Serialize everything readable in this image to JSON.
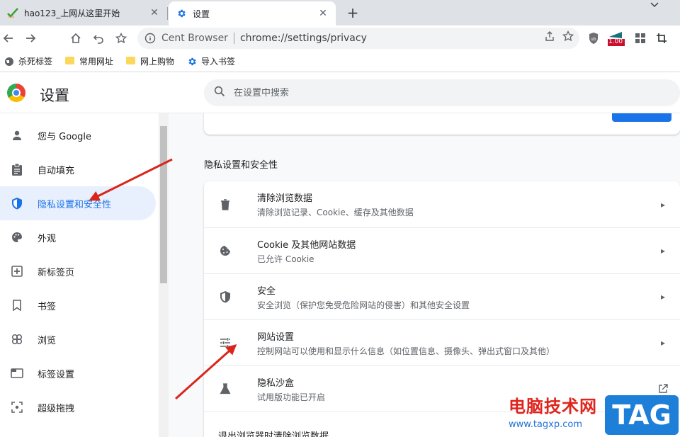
{
  "tabs": [
    {
      "title": "hao123_上网从这里开始",
      "active": false
    },
    {
      "title": "设置",
      "active": true
    }
  ],
  "toolbar": {
    "brand": "Cent Browser",
    "url": "chrome://settings/privacy",
    "ext_badge": "1.00"
  },
  "bookmarks": [
    {
      "label": "杀死标签",
      "icon": "globe-icon"
    },
    {
      "label": "常用网址",
      "icon": "folder-icon"
    },
    {
      "label": "网上购物",
      "icon": "folder-icon"
    },
    {
      "label": "导入书签",
      "icon": "gear-icon"
    }
  ],
  "header": {
    "title": "设置",
    "search_placeholder": "在设置中搜索"
  },
  "sidebar": {
    "items": [
      {
        "label": "您与 Google",
        "icon": "person-icon"
      },
      {
        "label": "自动填充",
        "icon": "clipboard-icon"
      },
      {
        "label": "隐私设置和安全性",
        "icon": "shield-icon",
        "active": true
      },
      {
        "label": "外观",
        "icon": "palette-icon"
      },
      {
        "label": "新标签页",
        "icon": "new-tab-icon"
      },
      {
        "label": "书签",
        "icon": "bookmark-icon"
      },
      {
        "label": "浏览",
        "icon": "browse-icon"
      },
      {
        "label": "标签设置",
        "icon": "tab-icon"
      },
      {
        "label": "超级拖拽",
        "icon": "drag-icon"
      }
    ]
  },
  "main": {
    "section_title": "隐私设置和安全性",
    "rows": [
      {
        "title": "清除浏览数据",
        "subtitle": "清除浏览记录、Cookie、缓存及其他数据",
        "icon": "trash-icon",
        "action": "chevron"
      },
      {
        "title": "Cookie 及其他网站数据",
        "subtitle": "已允许 Cookie",
        "icon": "cookie-icon",
        "action": "chevron"
      },
      {
        "title": "安全",
        "subtitle": "安全浏览（保护您免受危险网站的侵害）和其他安全设置",
        "icon": "shield-icon",
        "action": "chevron"
      },
      {
        "title": "网站设置",
        "subtitle": "控制网站可以使用和显示什么信息（如位置信息、摄像头、弹出式窗口及其他）",
        "icon": "sliders-icon",
        "action": "chevron"
      },
      {
        "title": "隐私沙盒",
        "subtitle": "试用版功能已开启",
        "icon": "flask-icon",
        "action": "external"
      },
      {
        "title": "退出浏览器时清除浏览数据",
        "subtitle": "",
        "icon": "",
        "action": "none"
      }
    ]
  },
  "watermark": {
    "cn": "电脑技术网",
    "url": "www.tagxp.com",
    "tag": "TAG"
  },
  "colors": {
    "accent": "#1a73e8",
    "active_bg": "#e8f0fe",
    "arrow": "#d9261c"
  }
}
